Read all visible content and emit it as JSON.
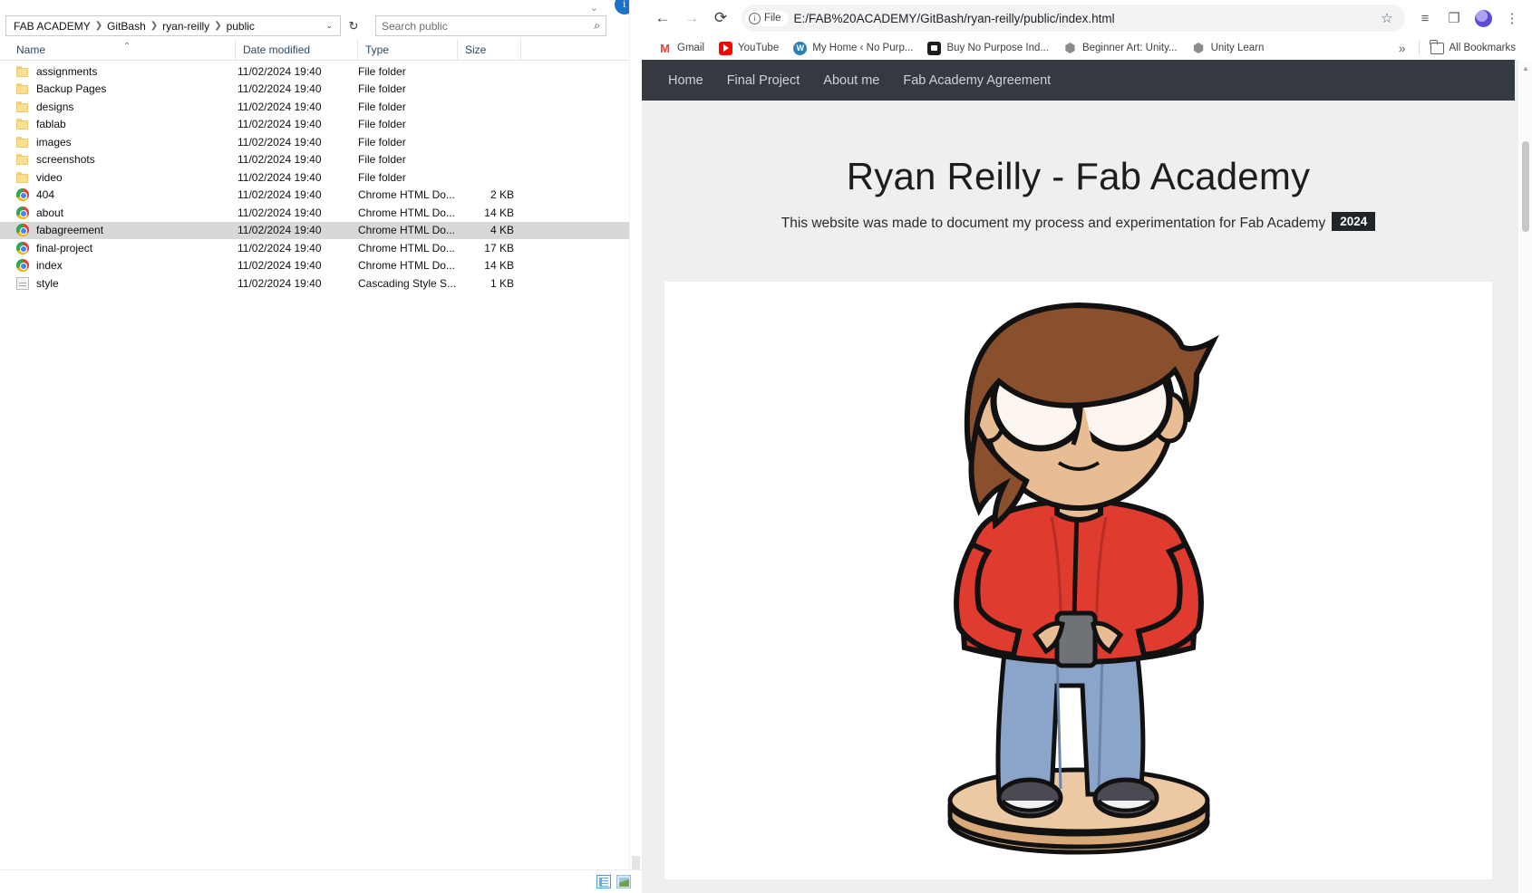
{
  "explorer": {
    "breadcrumb": [
      "FAB ACADEMY",
      "GitBash",
      "ryan-reilly",
      "public"
    ],
    "refresh_icon": "refresh-icon",
    "search": {
      "placeholder": "Search public",
      "icon": "search-icon"
    },
    "columns": [
      "Name",
      "Date modified",
      "Type",
      "Size"
    ],
    "rows": [
      {
        "name": "assignments",
        "date": "11/02/2024 19:40",
        "type": "File folder",
        "size": "",
        "icon": "folder-icon",
        "selected": false
      },
      {
        "name": "Backup Pages",
        "date": "11/02/2024 19:40",
        "type": "File folder",
        "size": "",
        "icon": "folder-icon",
        "selected": false
      },
      {
        "name": "designs",
        "date": "11/02/2024 19:40",
        "type": "File folder",
        "size": "",
        "icon": "folder-icon",
        "selected": false
      },
      {
        "name": "fablab",
        "date": "11/02/2024 19:40",
        "type": "File folder",
        "size": "",
        "icon": "folder-icon",
        "selected": false
      },
      {
        "name": "images",
        "date": "11/02/2024 19:40",
        "type": "File folder",
        "size": "",
        "icon": "folder-icon",
        "selected": false
      },
      {
        "name": "screenshots",
        "date": "11/02/2024 19:40",
        "type": "File folder",
        "size": "",
        "icon": "folder-icon",
        "selected": false
      },
      {
        "name": "video",
        "date": "11/02/2024 19:40",
        "type": "File folder",
        "size": "",
        "icon": "folder-icon",
        "selected": false
      },
      {
        "name": "404",
        "date": "11/02/2024 19:40",
        "type": "Chrome HTML Do...",
        "size": "2 KB",
        "icon": "chrome-html-icon",
        "selected": false
      },
      {
        "name": "about",
        "date": "11/02/2024 19:40",
        "type": "Chrome HTML Do...",
        "size": "14 KB",
        "icon": "chrome-html-icon",
        "selected": false
      },
      {
        "name": "fabagreement",
        "date": "11/02/2024 19:40",
        "type": "Chrome HTML Do...",
        "size": "4 KB",
        "icon": "chrome-html-icon",
        "selected": true
      },
      {
        "name": "final-project",
        "date": "11/02/2024 19:40",
        "type": "Chrome HTML Do...",
        "size": "17 KB",
        "icon": "chrome-html-icon",
        "selected": false
      },
      {
        "name": "index",
        "date": "11/02/2024 19:40",
        "type": "Chrome HTML Do...",
        "size": "14 KB",
        "icon": "chrome-html-icon",
        "selected": false
      },
      {
        "name": "style",
        "date": "11/02/2024 19:40",
        "type": "Cascading Style S...",
        "size": "1 KB",
        "icon": "css-file-icon",
        "selected": false
      }
    ],
    "status_buttons": [
      "details-view-button",
      "tiles-view-button"
    ]
  },
  "browser": {
    "nav": {
      "back": "back-arrow-icon",
      "forward": "forward-arrow-icon",
      "reload": "reload-icon"
    },
    "omnibox": {
      "chip_label": "File",
      "url": "E:/FAB%20ACADEMY/GitBash/ryan-reilly/public/index.html",
      "bookmark_star": "star-icon"
    },
    "toolbar_right": [
      "reading-list-icon",
      "side-panel-icon",
      "profile-avatar",
      "kebab-menu-icon"
    ],
    "bookmarks": [
      {
        "label": "Gmail",
        "icon": "gmail-icon"
      },
      {
        "label": "YouTube",
        "icon": "youtube-icon"
      },
      {
        "label": "My Home ‹ No Purp...",
        "icon": "wordpress-icon"
      },
      {
        "label": "Buy No Purpose Ind...",
        "icon": "dark-square-icon"
      },
      {
        "label": "Beginner Art: Unity...",
        "icon": "unity-icon"
      },
      {
        "label": "Unity Learn",
        "icon": "unity-icon"
      }
    ],
    "bookmarks_overflow": "»",
    "all_bookmarks_label": "All Bookmarks"
  },
  "site": {
    "nav_items": [
      "Home",
      "Final Project",
      "About me",
      "Fab Academy Agreement"
    ],
    "title": "Ryan Reilly - Fab Academy",
    "subtitle": "This website was made to document my process and experimentation for Fab Academy",
    "year_badge": "2024",
    "hero_image": "cartoon-avatar-illustration",
    "colors": {
      "nav_background": "#343a40",
      "page_background": "#efefef",
      "badge_background": "#212529",
      "hoodie_red": "#e03b2f",
      "hair_brown": "#8a4f2d",
      "jeans_blue": "#7b95bf",
      "skin": "#e6bd9c",
      "podium": "#dfb287"
    }
  }
}
